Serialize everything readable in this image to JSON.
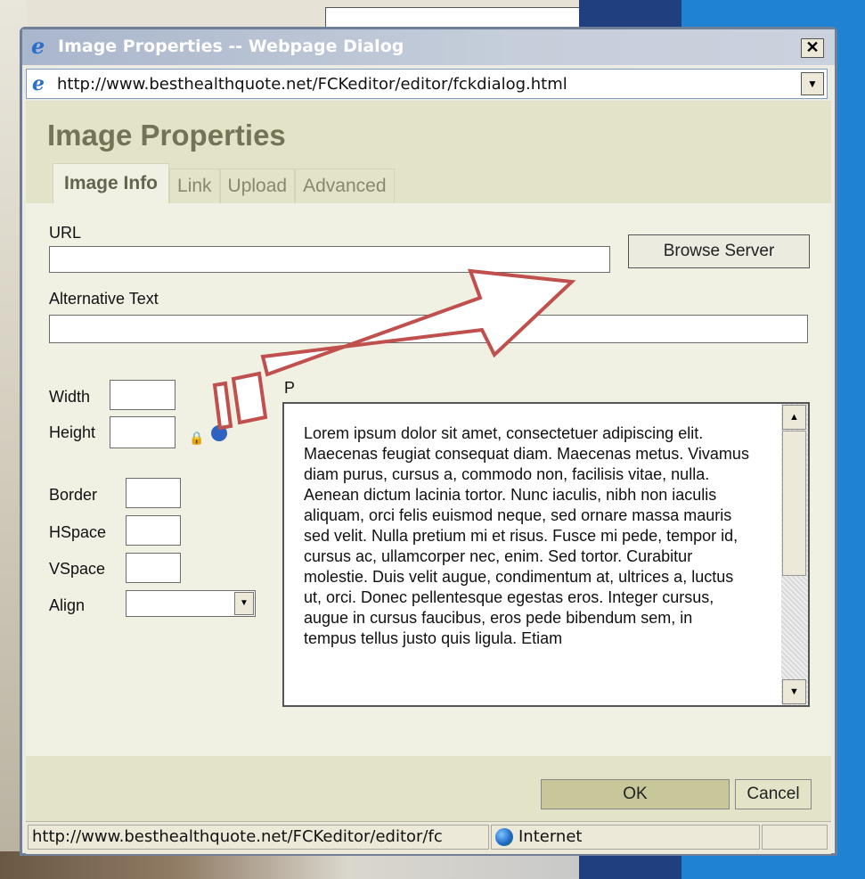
{
  "window": {
    "title": "Image Properties -- Webpage Dialog",
    "close": "✕",
    "address": "http://www.besthealthquote.net/FCKeditor/editor/fckdialog.html"
  },
  "dialog": {
    "title": "Image Properties",
    "tabs": [
      "Image Info",
      "Link",
      "Upload",
      "Advanced"
    ],
    "url_label": "URL",
    "url_value": "",
    "browse_label": "Browse Server",
    "alt_label": "Alternative Text",
    "alt_value": "",
    "width_label": "Width",
    "height_label": "Height",
    "border_label": "Border",
    "hspace_label": "HSpace",
    "vspace_label": "VSpace",
    "align_label": "Align",
    "preview_label": "P",
    "preview_text": "Lorem ipsum dolor sit amet, consectetuer adipiscing elit. Maecenas feugiat consequat diam. Maecenas metus. Vivamus diam purus, cursus a, commodo non, facilisis vitae, nulla. Aenean dictum lacinia tortor. Nunc iaculis, nibh non iaculis aliquam, orci felis euismod neque, sed ornare massa mauris sed velit. Nulla pretium mi et risus. Fusce mi pede, tempor id, cursus ac, ullamcorper nec, enim. Sed tortor. Curabitur molestie. Duis velit augue, condimentum at, ultrices a, luctus ut, orci. Donec pellentesque egestas eros. Integer cursus, augue in cursus faucibus, eros pede bibendum sem, in tempus tellus justo quis ligula. Etiam",
    "ok_label": "OK",
    "cancel_label": "Cancel"
  },
  "statusbar": {
    "url": "http://www.besthealthquote.net/FCKeditor/editor/fc",
    "zone": "Internet"
  },
  "colors": {
    "arrow": "#c0504d",
    "header_bg": "#e3e3c7",
    "title_text": "#737357"
  }
}
